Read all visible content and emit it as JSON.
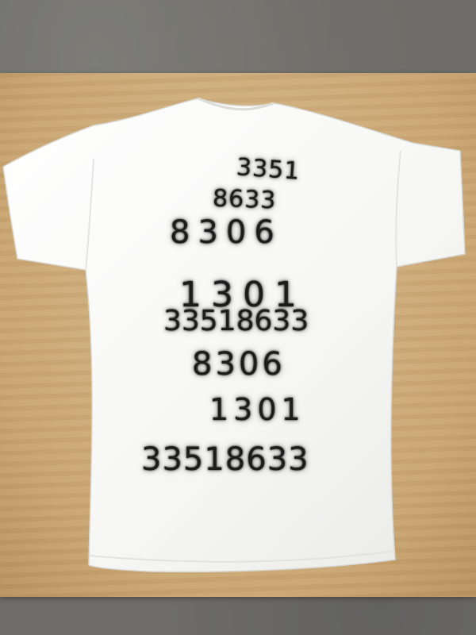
{
  "photo": {
    "subject": "t-shirt",
    "shirt_color": "#ffffff",
    "paint_color": "#1c1c1c",
    "board_color": "#d1b080",
    "floor_color": "#6d6c68"
  },
  "shirt_text": {
    "line1": "3351",
    "line2": "8633",
    "line3": "8306",
    "line4": "1301",
    "line5": "33518633",
    "line6": "8306",
    "line7": "1301",
    "line8": "33518633"
  }
}
